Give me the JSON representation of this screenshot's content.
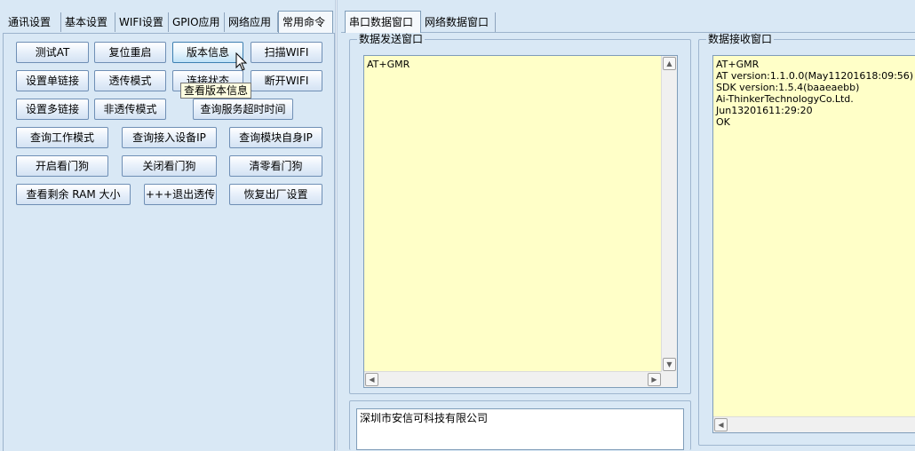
{
  "left_tabs": [
    {
      "label": "通讯设置"
    },
    {
      "label": "基本设置"
    },
    {
      "label": "WIFI设置"
    },
    {
      "label": "GPIO应用"
    },
    {
      "label": "网络应用"
    },
    {
      "label": "常用命令"
    }
  ],
  "left_tabs_active": "常用命令",
  "commands": {
    "test_at": "测试AT",
    "reset": "复位重启",
    "version_info": "版本信息",
    "scan_wifi": "扫描WIFI",
    "single_link": "设置单链接",
    "passthrough_mode": "透传模式",
    "connection_status": "连接状态",
    "disconnect_wifi": "断开WIFI",
    "multi_link": "设置多链接",
    "non_passthrough_mode": "非透传模式",
    "query_server_timeout": "查询服务超时时间",
    "query_work_mode": "查询工作模式",
    "query_connected_ip": "查询接入设备IP",
    "query_module_ip": "查询模块自身IP",
    "enable_watchdog": "开启看门狗",
    "disable_watchdog": "关闭看门狗",
    "clear_watchdog": "清零看门狗",
    "query_free_ram": "查看剩余 RAM 大小",
    "exit_passthrough": "+++退出透传",
    "factory_reset": "恢复出厂设置"
  },
  "tooltip": "查看版本信息",
  "right_tabs": [
    {
      "label": "串口数据窗口"
    },
    {
      "label": "网络数据窗口"
    }
  ],
  "right_tabs_active": "串口数据窗口",
  "send_window": {
    "title": "数据发送窗口",
    "content": "AT+GMR"
  },
  "receive_window": {
    "title": "数据接收窗口",
    "lines": [
      "AT+GMR",
      "AT version:1.1.0.0(May11201618:09:56)",
      "SDK version:1.5.4(baaeaebb)",
      "Ai-ThinkerTechnologyCo.Ltd.",
      "Jun13201611:29:20",
      "OK"
    ]
  },
  "company": "深圳市安信可科技有限公司",
  "icons": {
    "scroll_up": "scroll-up-arrow",
    "scroll_down": "scroll-down-arrow",
    "scroll_left": "scroll-left-arrow",
    "scroll_right": "scroll-right-arrow",
    "cursor": "mouse-pointer"
  },
  "colors": {
    "background": "#d9e8f5",
    "text_area": "#ffffc8",
    "tooltip": "#ffffe1",
    "button_border": "#6f8fb5"
  }
}
